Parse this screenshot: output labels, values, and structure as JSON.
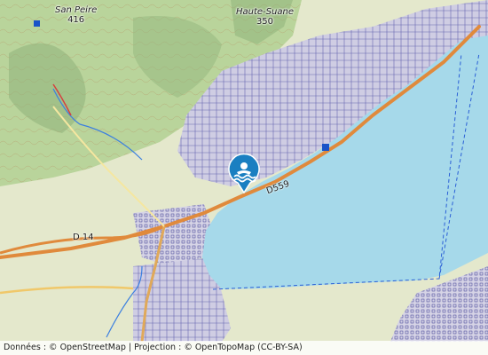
{
  "places": {
    "peak1": {
      "name": "San Peire",
      "elev": "416"
    },
    "peak2": {
      "name": "Haute-Suane",
      "elev": "350"
    }
  },
  "roads": {
    "main": "D559",
    "west": "D 14"
  },
  "marker": {
    "icon": "swimming-icon",
    "color": "#1a7fc1"
  },
  "attribution": {
    "text": "Données : © OpenStreetMap | Projection : © OpenTopoMap (CC-BY-SA)"
  },
  "colors": {
    "sea": "#a6d9ea",
    "forest": "#b9d29b",
    "land": "#e6e8cf",
    "urban": "#c8c7df",
    "road": "#e08a3c"
  }
}
